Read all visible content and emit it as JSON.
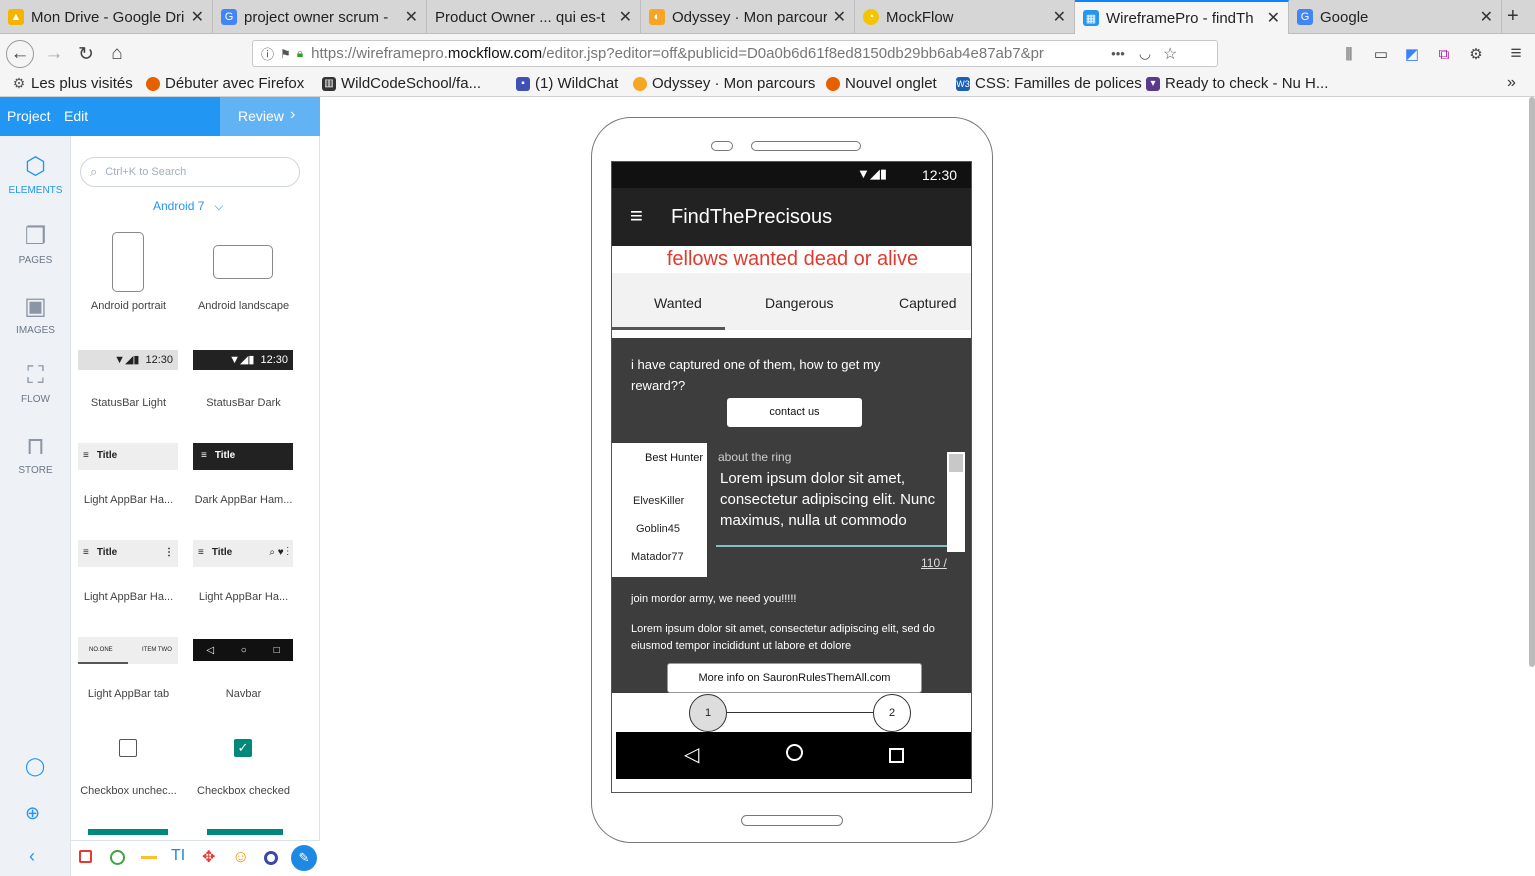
{
  "browser": {
    "tabs": [
      {
        "title": "Mon Drive - Google Dri",
        "icon": "google-drive-icon",
        "color": "#f4b400"
      },
      {
        "title": "project owner scrum - ",
        "icon": "google-icon",
        "color": "#4285f4"
      },
      {
        "title": "Product Owner ... qui es-t",
        "icon": "blank-icon",
        "color": "#999999"
      },
      {
        "title": "Odyssey · Mon parcour",
        "icon": "odyssey-icon",
        "color": "#f5a623"
      },
      {
        "title": "MockFlow",
        "icon": "mockflow-icon",
        "color": "#f5c400"
      },
      {
        "title": "WireframePro - findTh",
        "icon": "wireframepro-icon",
        "color": "#2196f3"
      },
      {
        "title": "Google",
        "icon": "google-icon",
        "color": "#4285f4"
      }
    ],
    "url_prefix": "https://wireframepro.",
    "url_domain": "mockflow.com",
    "url_rest": "/editor.jsp?editor=off&publicid=D0a0b6d61f8ed8150db29bb6ab4e87ab7&pr",
    "url_more": "•••",
    "bookmarks": [
      {
        "label": "Les plus visités",
        "icon": "gear-icon",
        "color": "#555555"
      },
      {
        "label": "Débuter avec Firefox",
        "icon": "firefox-icon",
        "color": "#e66000"
      },
      {
        "label": "WildCodeSchool/fa...",
        "icon": "github-icon",
        "color": "#333333"
      },
      {
        "label": "(1) WildChat",
        "icon": "chat-icon",
        "color": "#3f51b5"
      },
      {
        "label": "Odyssey · Mon parcours",
        "icon": "odyssey-icon",
        "color": "#f5a623"
      },
      {
        "label": "Nouvel onglet",
        "icon": "firefox-icon",
        "color": "#e66000"
      },
      {
        "label": "CSS: Familles de polices",
        "icon": "w3c-icon",
        "color": "#1a5fb4"
      },
      {
        "label": "Ready to check - Nu H...",
        "icon": "bookmark-icon",
        "color": "#5a3b8a"
      }
    ]
  },
  "app": {
    "menu": {
      "project": "Project",
      "edit": "Edit",
      "review": "Review"
    },
    "rail": [
      {
        "label": "ELEMENTS",
        "icon": "cube-icon",
        "glyph": "⬡",
        "selected": true
      },
      {
        "label": "PAGES",
        "icon": "pages-icon",
        "glyph": "❐",
        "selected": false
      },
      {
        "label": "IMAGES",
        "icon": "image-icon",
        "glyph": "▣",
        "selected": false
      },
      {
        "label": "FLOW",
        "icon": "flow-icon",
        "glyph": "⛶",
        "selected": false
      },
      {
        "label": "STORE",
        "icon": "store-icon",
        "glyph": "⊓",
        "selected": false
      }
    ],
    "search_placeholder": "Ctrl+K to Search",
    "platform": "Android 7",
    "components": [
      {
        "caption": "Android portrait"
      },
      {
        "caption": "Android landscape"
      },
      {
        "caption": "StatusBar Light",
        "time": "12:30"
      },
      {
        "caption": "StatusBar Dark",
        "time": "12:30"
      },
      {
        "caption": "Light AppBar Ha...",
        "title": "Title"
      },
      {
        "caption": "Dark AppBar Ham...",
        "title": "Title"
      },
      {
        "caption": "Light AppBar Ha...",
        "title": "Title"
      },
      {
        "caption": "Light AppBar Ha...",
        "title": "Title"
      },
      {
        "caption": "Light AppBar tab",
        "tab1": "NO.ONE",
        "tab2": "ITEM TWO"
      },
      {
        "caption": "Navbar"
      },
      {
        "caption": "Checkbox unchec..."
      },
      {
        "caption": "Checkbox checked"
      }
    ]
  },
  "mockup": {
    "time": "12:30",
    "app_title": "FindThePrecisous",
    "headline": "fellows wanted dead or alive",
    "tabs": [
      "Wanted",
      "Dangerous",
      "Captured"
    ],
    "card1": {
      "text": "i have captured one of them, how to get my reward??",
      "button": "contact us"
    },
    "list_header": "Best Hunter",
    "hunters": [
      "ElvesKiller",
      "Goblin45",
      "Matador77"
    ],
    "field": {
      "label": "about the ring",
      "value": "Lorem ipsum dolor sit amet, consectetur adipiscing elit. Nunc maximus, nulla ut commodo",
      "counter": "110 /"
    },
    "card2": {
      "title": "join mordor army, we need you!!!!!",
      "body": "Lorem ipsum dolor sit amet, consectetur adipiscing elit, sed do eiusmod tempor incididunt ut labore et dolore",
      "button": "More info on SauronRulesThemAll.com"
    },
    "stepper": [
      "1",
      "2"
    ]
  }
}
